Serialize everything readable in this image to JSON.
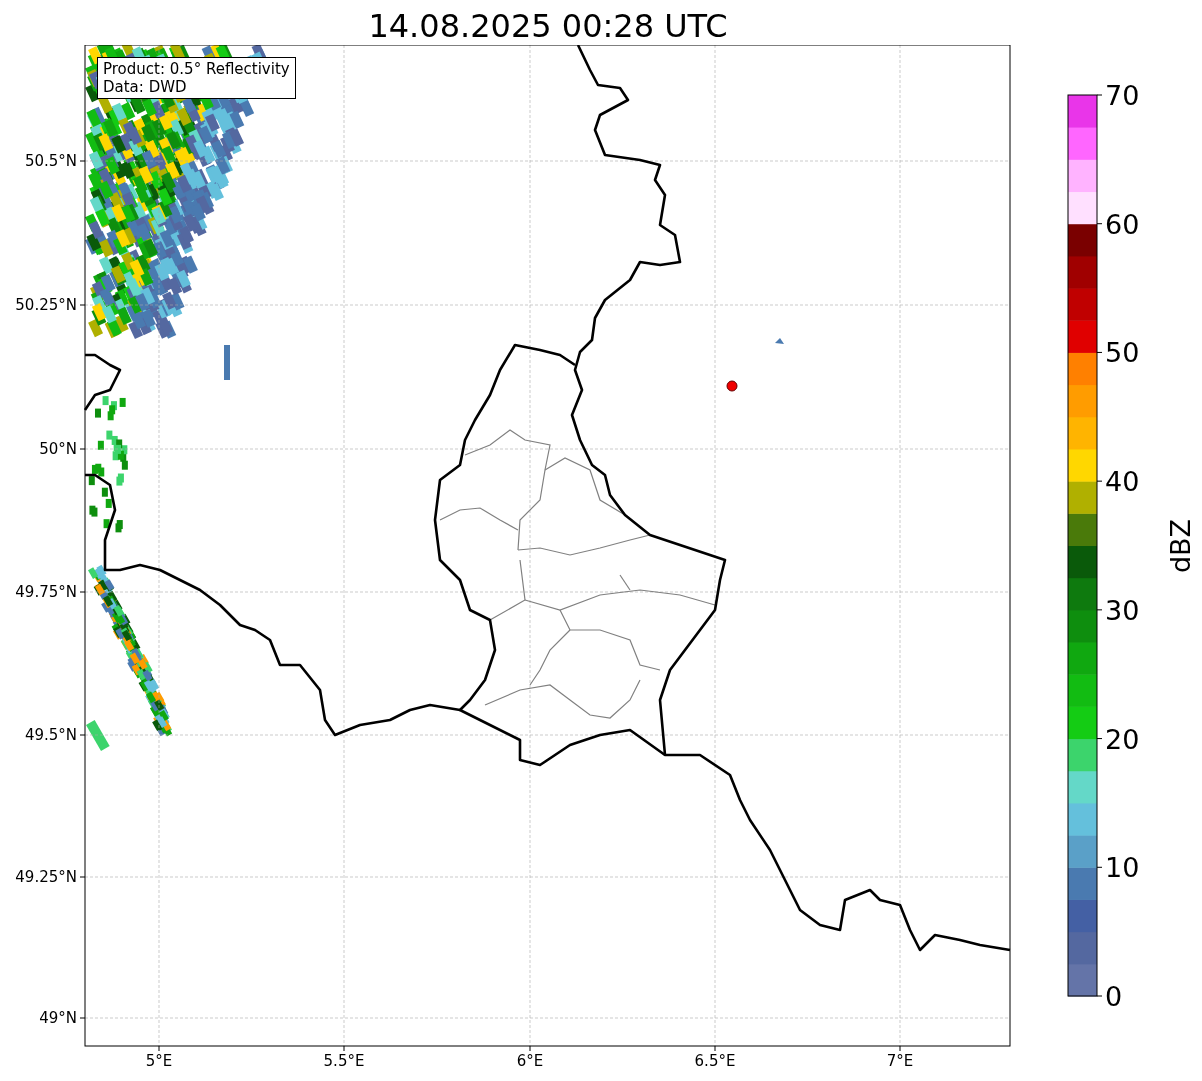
{
  "title": "14.08.2025 00:28 UTC",
  "legend": {
    "lines": [
      "Product: 0.5° Reflectivity",
      "Data: DWD"
    ]
  },
  "map": {
    "x_ticks": [
      "5°E",
      "5.5°E",
      "6°E",
      "6.5°E",
      "7°E"
    ],
    "y_ticks": [
      "50.5°N",
      "50.25°N",
      "50°N",
      "49.75°N",
      "49.5°N",
      "49.25°N",
      "49°N"
    ]
  },
  "colorbar": {
    "label": "dBZ",
    "ticks": [
      "70",
      "60",
      "50",
      "40",
      "30",
      "20",
      "10",
      "0"
    ],
    "bins": [
      {
        "color": "#6474a8"
      },
      {
        "color": "#5468a0"
      },
      {
        "color": "#4460a4"
      },
      {
        "color": "#4a7ab0"
      },
      {
        "color": "#5aa0c8"
      },
      {
        "color": "#64c0dc"
      },
      {
        "color": "#64d8c8"
      },
      {
        "color": "#3cd46c"
      },
      {
        "color": "#14cc14"
      },
      {
        "color": "#12bc12"
      },
      {
        "color": "#10a810"
      },
      {
        "color": "#0e8e0e"
      },
      {
        "color": "#0e7a0e"
      },
      {
        "color": "#0a5a0a"
      },
      {
        "color": "#4a7a0a"
      },
      {
        "color": "#b0b000"
      },
      {
        "color": "#ffd700"
      },
      {
        "color": "#ffb400"
      },
      {
        "color": "#ff9c00"
      },
      {
        "color": "#ff8000"
      },
      {
        "color": "#e00000"
      },
      {
        "color": "#c00000"
      },
      {
        "color": "#a00000"
      },
      {
        "color": "#7a0000"
      },
      {
        "color": "#ffe0ff"
      },
      {
        "color": "#ffb3ff"
      },
      {
        "color": "#ff66ff"
      },
      {
        "color": "#e935e9"
      }
    ]
  }
}
